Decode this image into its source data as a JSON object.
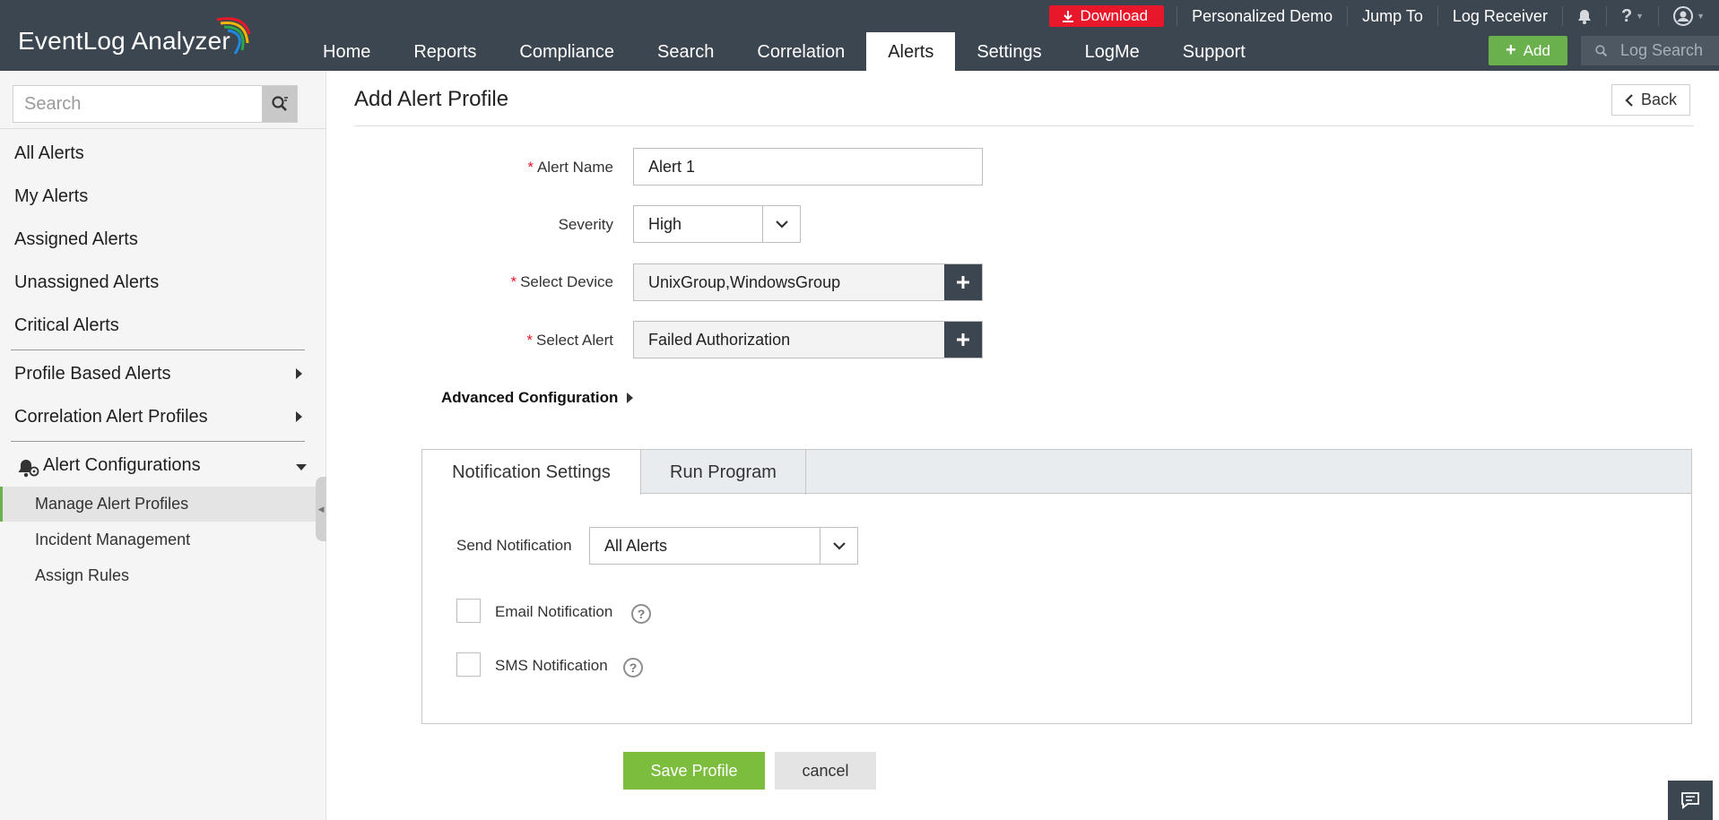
{
  "app": {
    "logo_text": "EventLog Analyzer"
  },
  "topbar": {
    "download_label": "Download",
    "links": [
      "Personalized Demo",
      "Jump To",
      "Log Receiver"
    ],
    "help_label": "?"
  },
  "nav": {
    "items": [
      "Home",
      "Reports",
      "Compliance",
      "Search",
      "Correlation",
      "Alerts",
      "Settings",
      "LogMe",
      "Support"
    ],
    "active": "Alerts",
    "add_label": "Add",
    "log_search_placeholder": "Log Search"
  },
  "sidebar": {
    "search_placeholder": "Search",
    "items": [
      "All Alerts",
      "My Alerts",
      "Assigned Alerts",
      "Unassigned Alerts",
      "Critical Alerts"
    ],
    "groups": [
      "Profile Based Alerts",
      "Correlation Alert Profiles"
    ],
    "config_group": "Alert Configurations",
    "sub_items": [
      "Manage Alert Profiles",
      "Incident Management",
      "Assign Rules"
    ]
  },
  "main": {
    "title": "Add Alert Profile",
    "back_label": "Back",
    "form": {
      "alert_name_label": "Alert Name",
      "alert_name_value": "Alert 1",
      "severity_label": "Severity",
      "severity_value": "High",
      "select_device_label": "Select Device",
      "select_device_value": "UnixGroup,WindowsGroup",
      "select_alert_label": "Select Alert",
      "select_alert_value": "Failed Authorization",
      "required_mark": "*"
    },
    "advanced_label": "Advanced Configuration",
    "tabs": [
      "Notification Settings",
      "Run Program"
    ],
    "notification": {
      "send_label": "Send Notification",
      "send_value": "All Alerts",
      "email_label": "Email Notification",
      "sms_label": "SMS Notification",
      "help_glyph": "?"
    },
    "save_label": "Save Profile",
    "cancel_label": "cancel"
  },
  "colors": {
    "header_bg": "#3c4650",
    "download": "#e8172a",
    "accent_green": "#7cbd3e"
  }
}
